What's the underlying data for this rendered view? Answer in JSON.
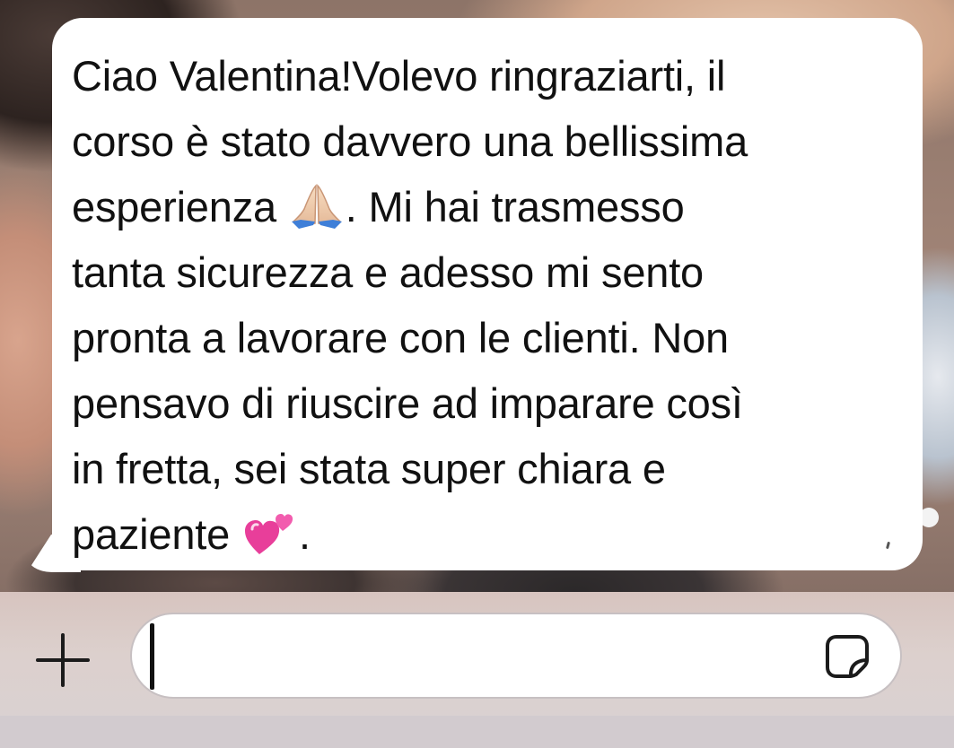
{
  "message": {
    "lines": [
      "Ciao Valentina!Volevo ringraziarti, il",
      "corso è stato davvero una bellissima",
      "esperienza",
      ". Mi hai trasmesso",
      "tanta sicurezza e adesso mi sento",
      "pronta a lavorare con le clienti. Non",
      "pensavo di riuscire ad imparare così",
      "in fretta, sei stata super chiara e",
      "paziente",
      "."
    ],
    "emojis": [
      "folded-hands-emoji",
      "two-hearts-emoji"
    ],
    "bubble_color": "#ffffff",
    "text_color": "#111111"
  },
  "input_bar": {
    "plus_icon": "plus-icon",
    "text_value": "",
    "sticker_icon": "sticker-icon"
  }
}
